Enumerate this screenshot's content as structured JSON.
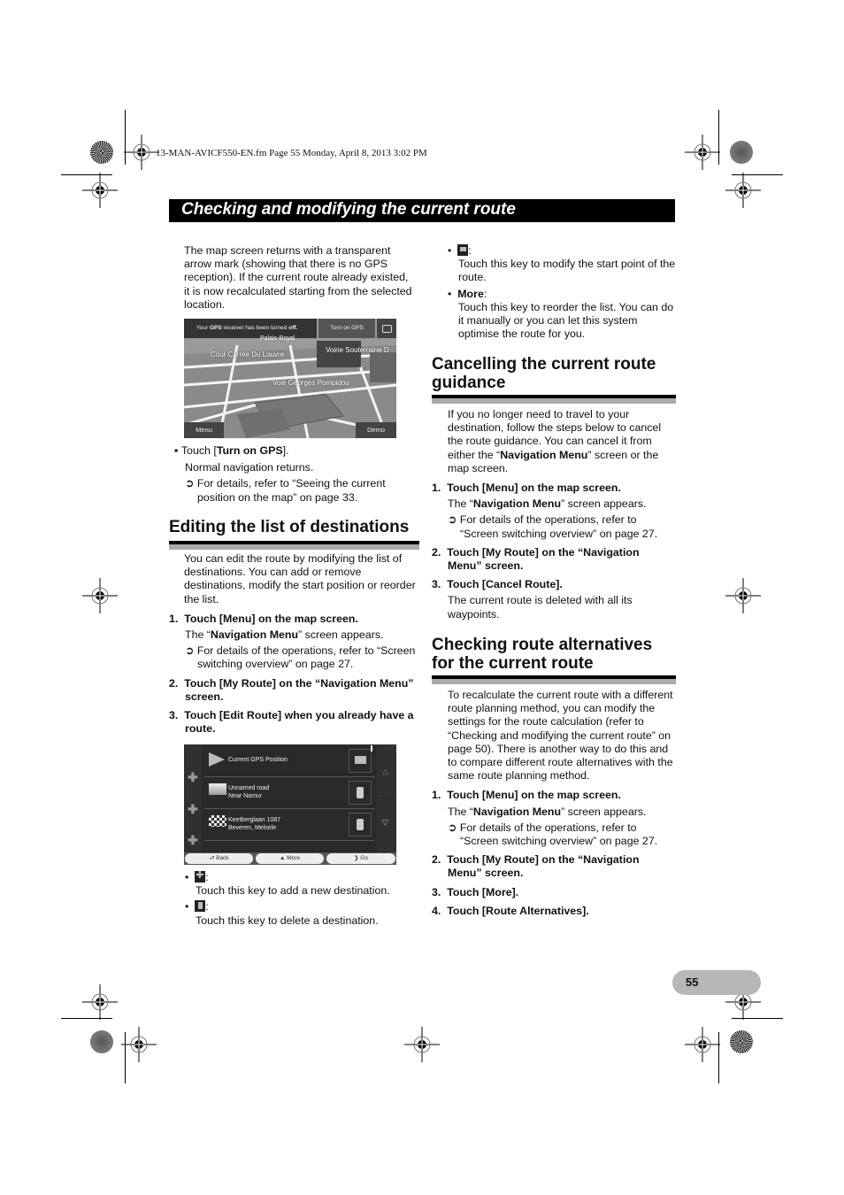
{
  "header": {
    "file_info": "13-MAN-AVICF550-EN.fm  Page 55  Monday, April 8, 2013  3:02 PM",
    "section_title": "Checking and modifying the current route"
  },
  "left": {
    "intro": "The map screen returns with a transparent arrow mark (showing that there is no GPS reception). If the current route already existed, it is now recalculated starting from the selected location.",
    "map_screenshot": {
      "banner_prefix": "Your ",
      "banner_gps": "GPS",
      "banner_mid": " receiver has been turned ",
      "banner_off": "off.",
      "turn_on_button": "Turn on GPS",
      "labels": [
        "Palais-Royal",
        "Cour Carrée Du Louvre",
        "Voirie Souterraine D",
        "Voie Georges Pompidou"
      ],
      "menu_button": "Menu",
      "demo_button": "Demo"
    },
    "turn_on": {
      "prefix": "Touch [",
      "bold": "Turn on GPS",
      "suffix": "].",
      "result": "Normal navigation returns.",
      "ref": "For details, refer to “Seeing the current position on the map” on page 33."
    },
    "heading_edit": "Editing the list of destinations",
    "edit_intro": "You can edit the route by modifying the list of destinations. You can add or remove destinations, modify the start position or reorder the list.",
    "steps": [
      {
        "num": "1.",
        "text": "Touch [Menu] on the map screen."
      },
      {
        "num": "2.",
        "text": "Touch [My Route] on the “Navigation Menu” screen."
      },
      {
        "num": "3.",
        "text": "Touch [Edit Route] when you already have a route."
      }
    ],
    "step1_result_pre": "The “",
    "step1_result_bold": "Navigation Menu",
    "step1_result_post": "” screen appears.",
    "step1_ref": "For details of the operations, refer to “Screen switching overview” on page 27.",
    "list_screenshot": {
      "rows": [
        {
          "line1": "Current GPS Position",
          "line2": "",
          "icon": "arrow-icon",
          "action": "flag-icon"
        },
        {
          "line1": "Unnamed road",
          "line2": "Near Namur",
          "icon": "flag-icon",
          "action": "trash-icon"
        },
        {
          "line1": "Keetberglaan 1087",
          "line2": "Beveren, Melsele",
          "icon": "checkered-flag-icon",
          "action": "trash-icon"
        }
      ],
      "back_button": "Back",
      "more_button": "More",
      "go_button": "Go"
    },
    "bullets": [
      {
        "icon": "plus-icon",
        "text": "Touch this key to add a new destination."
      },
      {
        "icon": "trash-icon",
        "text": "Touch this key to delete a destination."
      }
    ]
  },
  "right": {
    "bullets": [
      {
        "icon": "flag-icon",
        "label": "",
        "text": "Touch this key to modify the start point of the route."
      },
      {
        "icon": "",
        "label": "More",
        "text": "Touch this key to reorder the list. You can do it manually or you can let this system optimise the route for you."
      }
    ],
    "heading_cancel": "Cancelling the current route guidance",
    "cancel_intro_pre": "If you no longer need to travel to your destination, follow the steps below to cancel the route guidance. You can cancel it from either the “",
    "cancel_intro_bold": "Navigation Menu",
    "cancel_intro_post": "” screen or the map screen.",
    "cancel_steps": [
      {
        "num": "1.",
        "text": "Touch [Menu] on the map screen."
      },
      {
        "num": "2.",
        "text": "Touch [My Route] on the “Navigation Menu” screen."
      },
      {
        "num": "3.",
        "text": "Touch [Cancel Route]."
      }
    ],
    "cancel_step1_ref": "For details of the operations, refer to “Screen switching overview” on page 27.",
    "cancel_step3_result": "The current route is deleted with all its waypoints.",
    "heading_alt": "Checking route alternatives for the current route",
    "alt_intro": "To recalculate the current route with a different route planning method, you can modify the settings for the route calculation (refer to “Checking and modifying the current route” on page 50). There is another way to do this and to compare different route alternatives with the same route planning method.",
    "alt_steps": [
      {
        "num": "1.",
        "text": "Touch [Menu] on the map screen."
      },
      {
        "num": "2.",
        "text": "Touch [My Route] on the “Navigation Menu” screen."
      },
      {
        "num": "3.",
        "text": "Touch [More]."
      },
      {
        "num": "4.",
        "text": "Touch [Route Alternatives]."
      }
    ],
    "alt_step1_ref": "For details of the operations, refer to “Screen switching overview” on page 27."
  },
  "footer": {
    "page_number": "55"
  },
  "common": {
    "result_pre": "The “",
    "result_bold": "Navigation Menu",
    "result_post": "” screen appears.",
    "ref_arrow": "➲",
    "bullet_square": "▪",
    "bullet_dot": "•",
    "colon": ":"
  }
}
